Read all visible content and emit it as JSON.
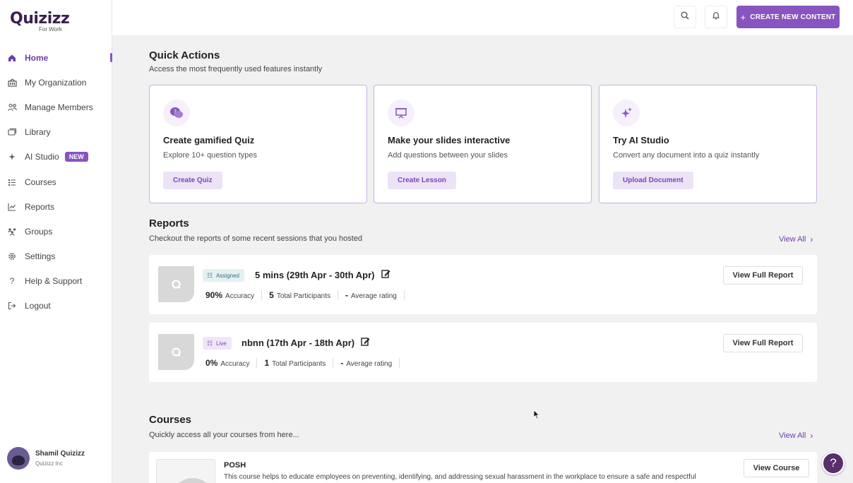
{
  "brand": {
    "name": "Quizizz",
    "sub": "For Work"
  },
  "sidebar": {
    "items": [
      {
        "label": "Home",
        "icon": "home-icon"
      },
      {
        "label": "My Organization",
        "icon": "building-icon"
      },
      {
        "label": "Manage Members",
        "icon": "members-icon"
      },
      {
        "label": "Library",
        "icon": "library-icon"
      },
      {
        "label": "AI Studio",
        "icon": "sparkle-icon",
        "badge": "NEW"
      },
      {
        "label": "Courses",
        "icon": "courses-icon"
      },
      {
        "label": "Reports",
        "icon": "chart-icon"
      },
      {
        "label": "Groups",
        "icon": "groups-icon"
      },
      {
        "label": "Settings",
        "icon": "gear-icon"
      },
      {
        "label": "Help & Support",
        "icon": "question-icon"
      },
      {
        "label": "Logout",
        "icon": "logout-icon"
      }
    ],
    "active": "Home",
    "user": {
      "name": "Shamil Quizizz",
      "org": "Quizizz Inc"
    }
  },
  "topbar": {
    "create_label": "CREATE NEW CONTENT"
  },
  "quick_actions": {
    "title": "Quick Actions",
    "subtitle": "Access the most frequently used features instantly",
    "cards": [
      {
        "title": "Create gamified Quiz",
        "desc": "Explore 10+ question types",
        "button": "Create Quiz",
        "icon": "quiz-chat-icon"
      },
      {
        "title": "Make your slides interactive",
        "desc": "Add questions between your slides",
        "button": "Create Lesson",
        "icon": "presentation-icon"
      },
      {
        "title": "Try AI Studio",
        "desc": "Convert any document into a quiz instantly",
        "button": "Upload Document",
        "icon": "sparkle-icon"
      }
    ]
  },
  "reports": {
    "title": "Reports",
    "subtitle": "Checkout the reports of some recent sessions that you hosted",
    "view_all": "View All",
    "items": [
      {
        "tag": "Assigned",
        "title": "5 mins (29th Apr - 30th Apr)",
        "accuracy_value": "90%",
        "accuracy_label": "Accuracy",
        "participants_value": "5",
        "participants_label": "Total Participants",
        "rating_value": "-",
        "rating_label": "Average rating",
        "button": "View Full Report"
      },
      {
        "tag": "Live",
        "title": "nbnn (17th Apr - 18th Apr)",
        "accuracy_value": "0%",
        "accuracy_label": "Accuracy",
        "participants_value": "1",
        "participants_label": "Total Participants",
        "rating_value": "-",
        "rating_label": "Average rating",
        "button": "View Full Report"
      }
    ]
  },
  "courses": {
    "title": "Courses",
    "subtitle": "Quickly access all your courses from here...",
    "view_all": "View All",
    "items": [
      {
        "title": "POSH",
        "desc": "This course helps to educate employees on preventing, identifying, and addressing sexual harassment in the workplace to ensure a safe and respectful",
        "button": "View Course"
      }
    ]
  },
  "help_fab": "?",
  "colors": {
    "accent": "#8854c0",
    "accent_light": "#ede3f7",
    "sidebar_bg": "#ffffff",
    "main_bg": "#f1f1f1"
  }
}
